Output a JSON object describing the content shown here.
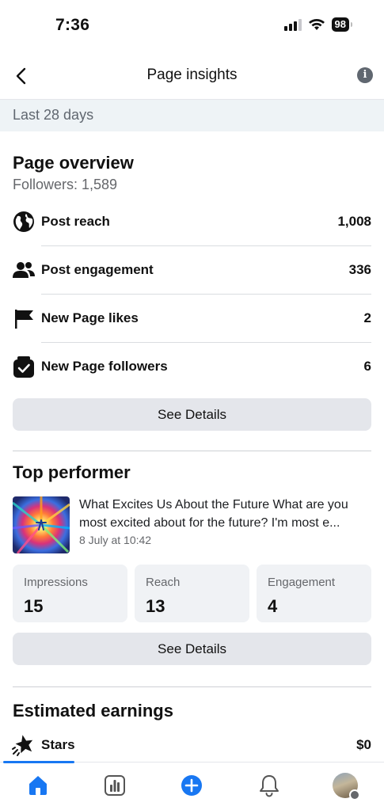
{
  "status_bar": {
    "time": "7:36",
    "battery": "98",
    "signal_bars": 4,
    "signal_filled": 3
  },
  "header": {
    "title": "Page insights",
    "back_icon": "chevron-left-icon",
    "info_icon": "info-icon",
    "info_glyph": "i"
  },
  "period": {
    "label": "Last 28 days"
  },
  "overview": {
    "title": "Page overview",
    "followers": "Followers: 1,589",
    "metrics": [
      {
        "label": "Post reach",
        "value": "1,008",
        "icon": "globe-icon"
      },
      {
        "label": "Post engagement",
        "value": "336",
        "icon": "people-icon"
      },
      {
        "label": "New Page likes",
        "value": "2",
        "icon": "flag-icon"
      },
      {
        "label": "New Page followers",
        "value": "6",
        "icon": "follower-check-icon"
      }
    ],
    "details_button": "See Details"
  },
  "top_performer": {
    "title": "Top performer",
    "post_text": "What Excites Us About the Future What are you most excited about for the future? I'm most e...",
    "post_date": "8 July at 10:42",
    "stats": [
      {
        "label": "Impressions",
        "value": "15"
      },
      {
        "label": "Reach",
        "value": "13"
      },
      {
        "label": "Engagement",
        "value": "4"
      }
    ],
    "details_button": "See Details"
  },
  "earnings": {
    "title": "Estimated earnings",
    "rows": [
      {
        "label": "Stars",
        "value": "$0",
        "icon": "stars-icon"
      }
    ]
  },
  "bottom_nav": {
    "items": [
      "home-icon",
      "insights-icon",
      "create-icon",
      "notifications-icon",
      "profile-avatar"
    ],
    "active": "home-icon",
    "accent": "#1877f2"
  }
}
